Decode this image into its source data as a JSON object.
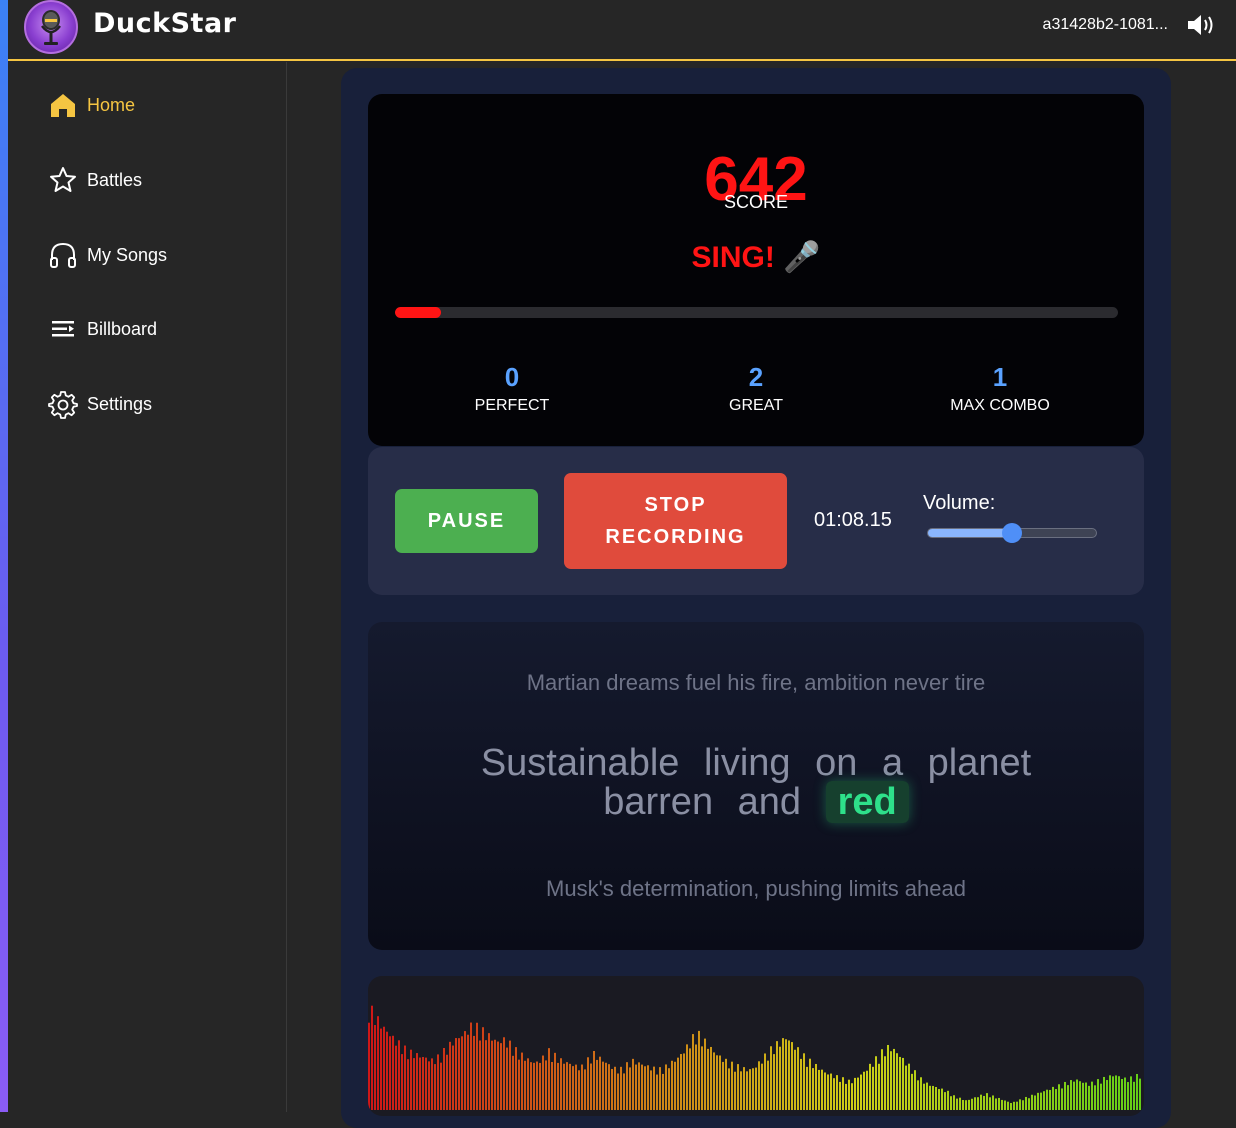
{
  "app": {
    "brand": "DuckStar",
    "user_id": "a31428b2-1081...",
    "accent": "#f5c542"
  },
  "sidebar": {
    "items": [
      {
        "label": "Home",
        "icon": "home-icon",
        "active": true
      },
      {
        "label": "Battles",
        "icon": "star-icon",
        "active": false
      },
      {
        "label": "My Songs",
        "icon": "headphones-icon",
        "active": false
      },
      {
        "label": "Billboard",
        "icon": "list-icon",
        "active": false
      },
      {
        "label": "Settings",
        "icon": "gear-icon",
        "active": false
      }
    ]
  },
  "score": {
    "value": "642",
    "label": "SCORE",
    "prompt": "SING! 🎤",
    "progress": 0.063,
    "stats": [
      {
        "value": "0",
        "label": "PERFECT"
      },
      {
        "value": "2",
        "label": "GREAT"
      },
      {
        "value": "1",
        "label": "MAX COMBO"
      }
    ]
  },
  "controls": {
    "pause_label": "PAUSE",
    "stop_label": "STOP RECORDING",
    "timer": "01:08.15",
    "volume_label": "Volume:",
    "volume": 0.5
  },
  "lyrics": {
    "previous": "Martian dreams fuel his fire, ambition never tire",
    "current_before": "Sustainable living on a planet barren and",
    "current_highlight": "red",
    "next": "Musk's determination, pushing limits ahead"
  },
  "visualizer": {
    "levels": [
      0.88,
      0.8,
      0.72,
      0.66,
      0.6,
      0.55,
      0.5,
      0.48,
      0.46,
      0.44,
      0.42,
      0.46,
      0.52,
      0.58,
      0.62,
      0.66,
      0.72,
      0.7,
      0.66,
      0.62,
      0.58,
      0.6,
      0.56,
      0.5,
      0.46,
      0.42,
      0.4,
      0.44,
      0.5,
      0.46,
      0.42,
      0.4,
      0.38,
      0.36,
      0.42,
      0.48,
      0.44,
      0.4,
      0.36,
      0.34,
      0.38,
      0.42,
      0.4,
      0.38,
      0.36,
      0.34,
      0.36,
      0.4,
      0.44,
      0.5,
      0.58,
      0.66,
      0.6,
      0.54,
      0.48,
      0.44,
      0.4,
      0.38,
      0.36,
      0.34,
      0.36,
      0.42,
      0.48,
      0.54,
      0.58,
      0.62,
      0.56,
      0.5,
      0.44,
      0.4,
      0.36,
      0.32,
      0.3,
      0.28,
      0.26,
      0.24,
      0.28,
      0.32,
      0.38,
      0.44,
      0.5,
      0.54,
      0.5,
      0.44,
      0.38,
      0.32,
      0.26,
      0.22,
      0.2,
      0.18,
      0.16,
      0.12,
      0.1,
      0.08,
      0.1,
      0.12,
      0.14,
      0.12,
      0.1,
      0.08,
      0.06,
      0.08,
      0.1,
      0.12,
      0.14,
      0.16,
      0.18,
      0.2,
      0.22,
      0.24,
      0.26,
      0.24,
      0.22,
      0.24,
      0.26,
      0.28,
      0.3,
      0.28,
      0.26,
      0.28,
      0.3
    ]
  }
}
